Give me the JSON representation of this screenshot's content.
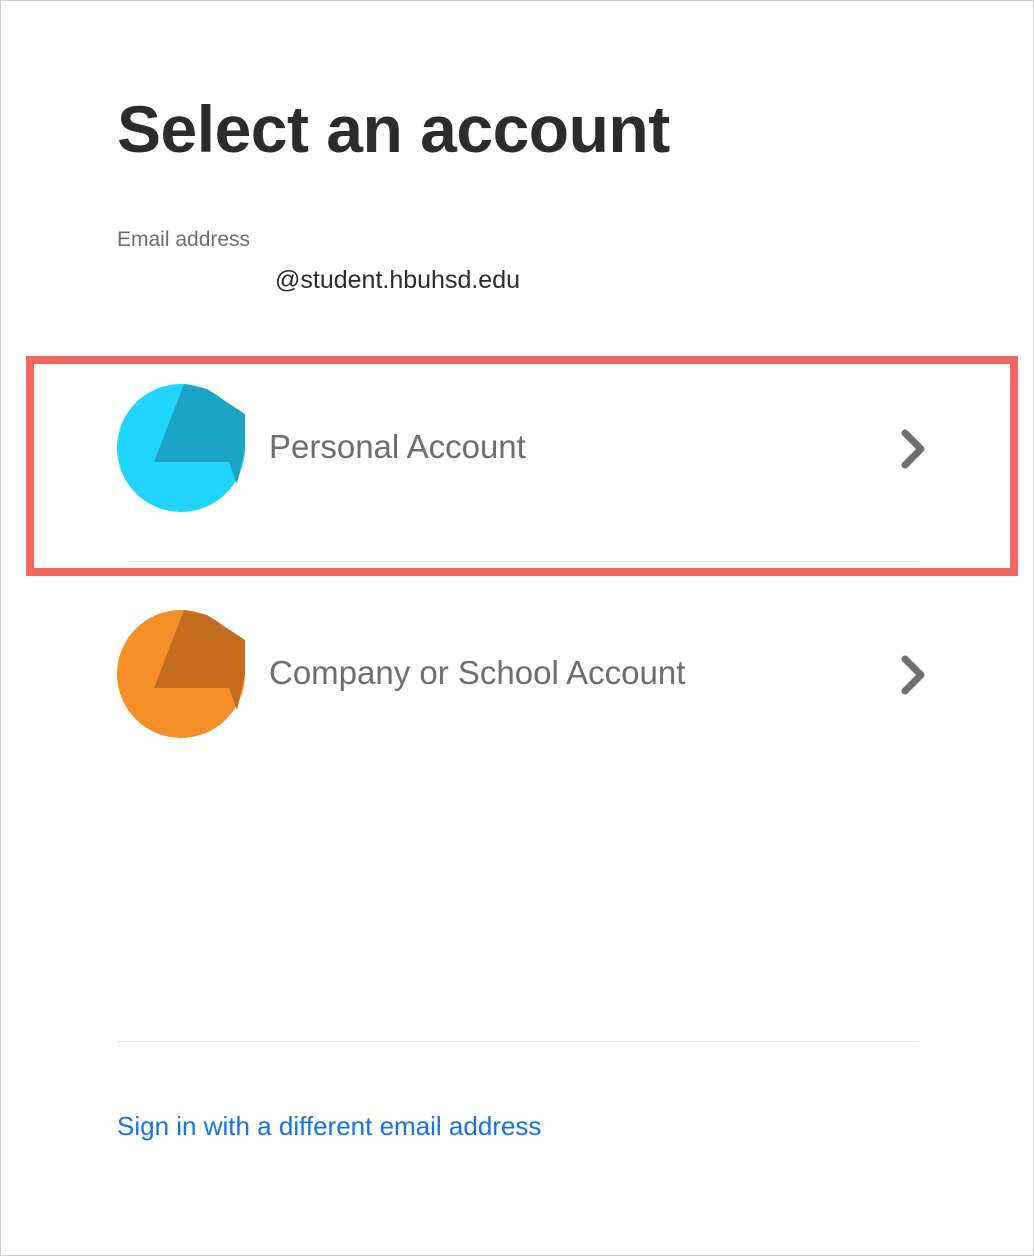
{
  "dialog": {
    "title": "Select an account",
    "email_label": "Email address",
    "email_value": "@student.hbuhsd.edu"
  },
  "accounts": [
    {
      "label": "Personal Account",
      "icon": "personal-account-avatar-icon",
      "colors": {
        "primary": "#22d3fc",
        "secondary": "#1ba3c8"
      },
      "highlighted": true
    },
    {
      "label": "Company or School Account",
      "icon": "company-account-avatar-icon",
      "colors": {
        "primary": "#f48f27",
        "secondary": "#c46d1e"
      },
      "highlighted": false
    }
  ],
  "footer": {
    "alt_signin_label": "Sign in with a different email address"
  },
  "colors": {
    "highlight": "#f26660",
    "link": "#1473e6",
    "text_dark": "#2c2c2c",
    "text_muted": "#6e6e6e",
    "chevron": "#707070"
  }
}
